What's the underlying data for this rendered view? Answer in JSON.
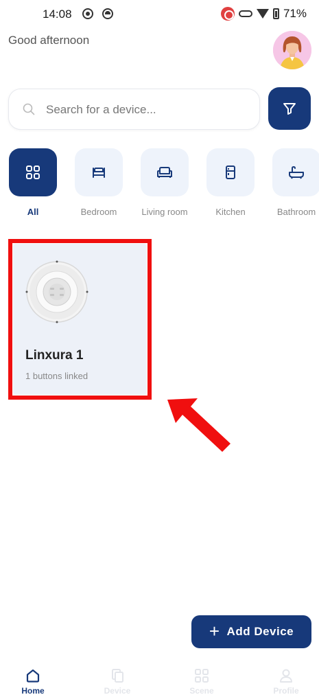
{
  "status_bar": {
    "time": "14:08",
    "battery": "71%"
  },
  "header": {
    "greeting": "Good afternoon",
    "avatar_icon": "user-avatar"
  },
  "search": {
    "placeholder": "Search for a device...",
    "value": ""
  },
  "categories": [
    {
      "label": "All",
      "icon": "grid-icon",
      "active": true
    },
    {
      "label": "Bedroom",
      "icon": "bed-icon",
      "active": false
    },
    {
      "label": "Living room",
      "icon": "sofa-icon",
      "active": false
    },
    {
      "label": "Kitchen",
      "icon": "fridge-icon",
      "active": false
    },
    {
      "label": "Bathroom",
      "icon": "bathtub-icon",
      "active": false
    }
  ],
  "devices": [
    {
      "name": "Linxura 1",
      "subtitle": "1 buttons linked"
    }
  ],
  "add_device": {
    "label": "Add Device"
  },
  "bottom_nav": [
    {
      "label": "Home",
      "icon": "home-icon",
      "active": true
    },
    {
      "label": "Device",
      "icon": "device-icon",
      "active": false
    },
    {
      "label": "Scene",
      "icon": "scene-icon",
      "active": false
    },
    {
      "label": "Profile",
      "icon": "profile-icon",
      "active": false
    }
  ],
  "colors": {
    "primary": "#17397a",
    "tile_bg": "#eef3fb",
    "card_bg": "#edf1f8",
    "annotation": "#f00f0f"
  }
}
